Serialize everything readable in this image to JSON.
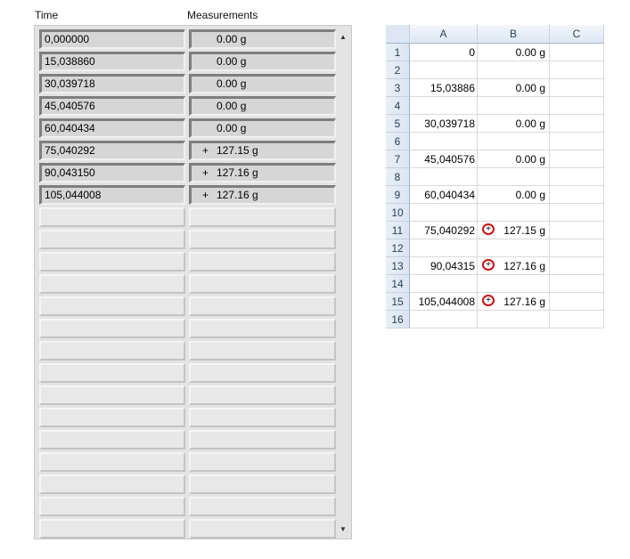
{
  "labview": {
    "time_header": "Time",
    "measurements_header": "Measurements",
    "rows": [
      {
        "time": "0,000000",
        "sign": "",
        "value": "0.00 g"
      },
      {
        "time": "15,038860",
        "sign": "",
        "value": "0.00 g"
      },
      {
        "time": "30,039718",
        "sign": "",
        "value": "0.00 g"
      },
      {
        "time": "45,040576",
        "sign": "",
        "value": "0.00 g"
      },
      {
        "time": "60,040434",
        "sign": "",
        "value": "0.00 g"
      },
      {
        "time": "75,040292",
        "sign": "+",
        "value": "127.15 g"
      },
      {
        "time": "90,043150",
        "sign": "+",
        "value": "127.16 g"
      },
      {
        "time": "105,044008",
        "sign": "+",
        "value": "127.16 g"
      }
    ],
    "empty_rows": 15,
    "scroll_up_icon": "▲",
    "scroll_down_icon": "▼"
  },
  "excel": {
    "columns": [
      "A",
      "B",
      "C"
    ],
    "rows": [
      {
        "num": "1",
        "a": "0",
        "b": "0.00 g",
        "plus": false
      },
      {
        "num": "2",
        "a": "",
        "b": "",
        "plus": false
      },
      {
        "num": "3",
        "a": "15,03886",
        "b": "0.00 g",
        "plus": false
      },
      {
        "num": "4",
        "a": "",
        "b": "",
        "plus": false
      },
      {
        "num": "5",
        "a": "30,039718",
        "b": "0.00 g",
        "plus": false
      },
      {
        "num": "6",
        "a": "",
        "b": "",
        "plus": false
      },
      {
        "num": "7",
        "a": "45,040576",
        "b": "0.00 g",
        "plus": false
      },
      {
        "num": "8",
        "a": "",
        "b": "",
        "plus": false
      },
      {
        "num": "9",
        "a": "60,040434",
        "b": "0.00 g",
        "plus": false
      },
      {
        "num": "10",
        "a": "",
        "b": "",
        "plus": false
      },
      {
        "num": "11",
        "a": "75,040292",
        "b": "127.15 g",
        "plus": true
      },
      {
        "num": "12",
        "a": "",
        "b": "",
        "plus": false
      },
      {
        "num": "13",
        "a": "90,04315",
        "b": "127.16 g",
        "plus": true
      },
      {
        "num": "14",
        "a": "",
        "b": "",
        "plus": false
      },
      {
        "num": "15",
        "a": "105,044008",
        "b": "127.16 g",
        "plus": true
      },
      {
        "num": "16",
        "a": "",
        "b": "",
        "plus": false
      }
    ],
    "plus_glyph": "+",
    "annotation_color": "#d01010"
  }
}
